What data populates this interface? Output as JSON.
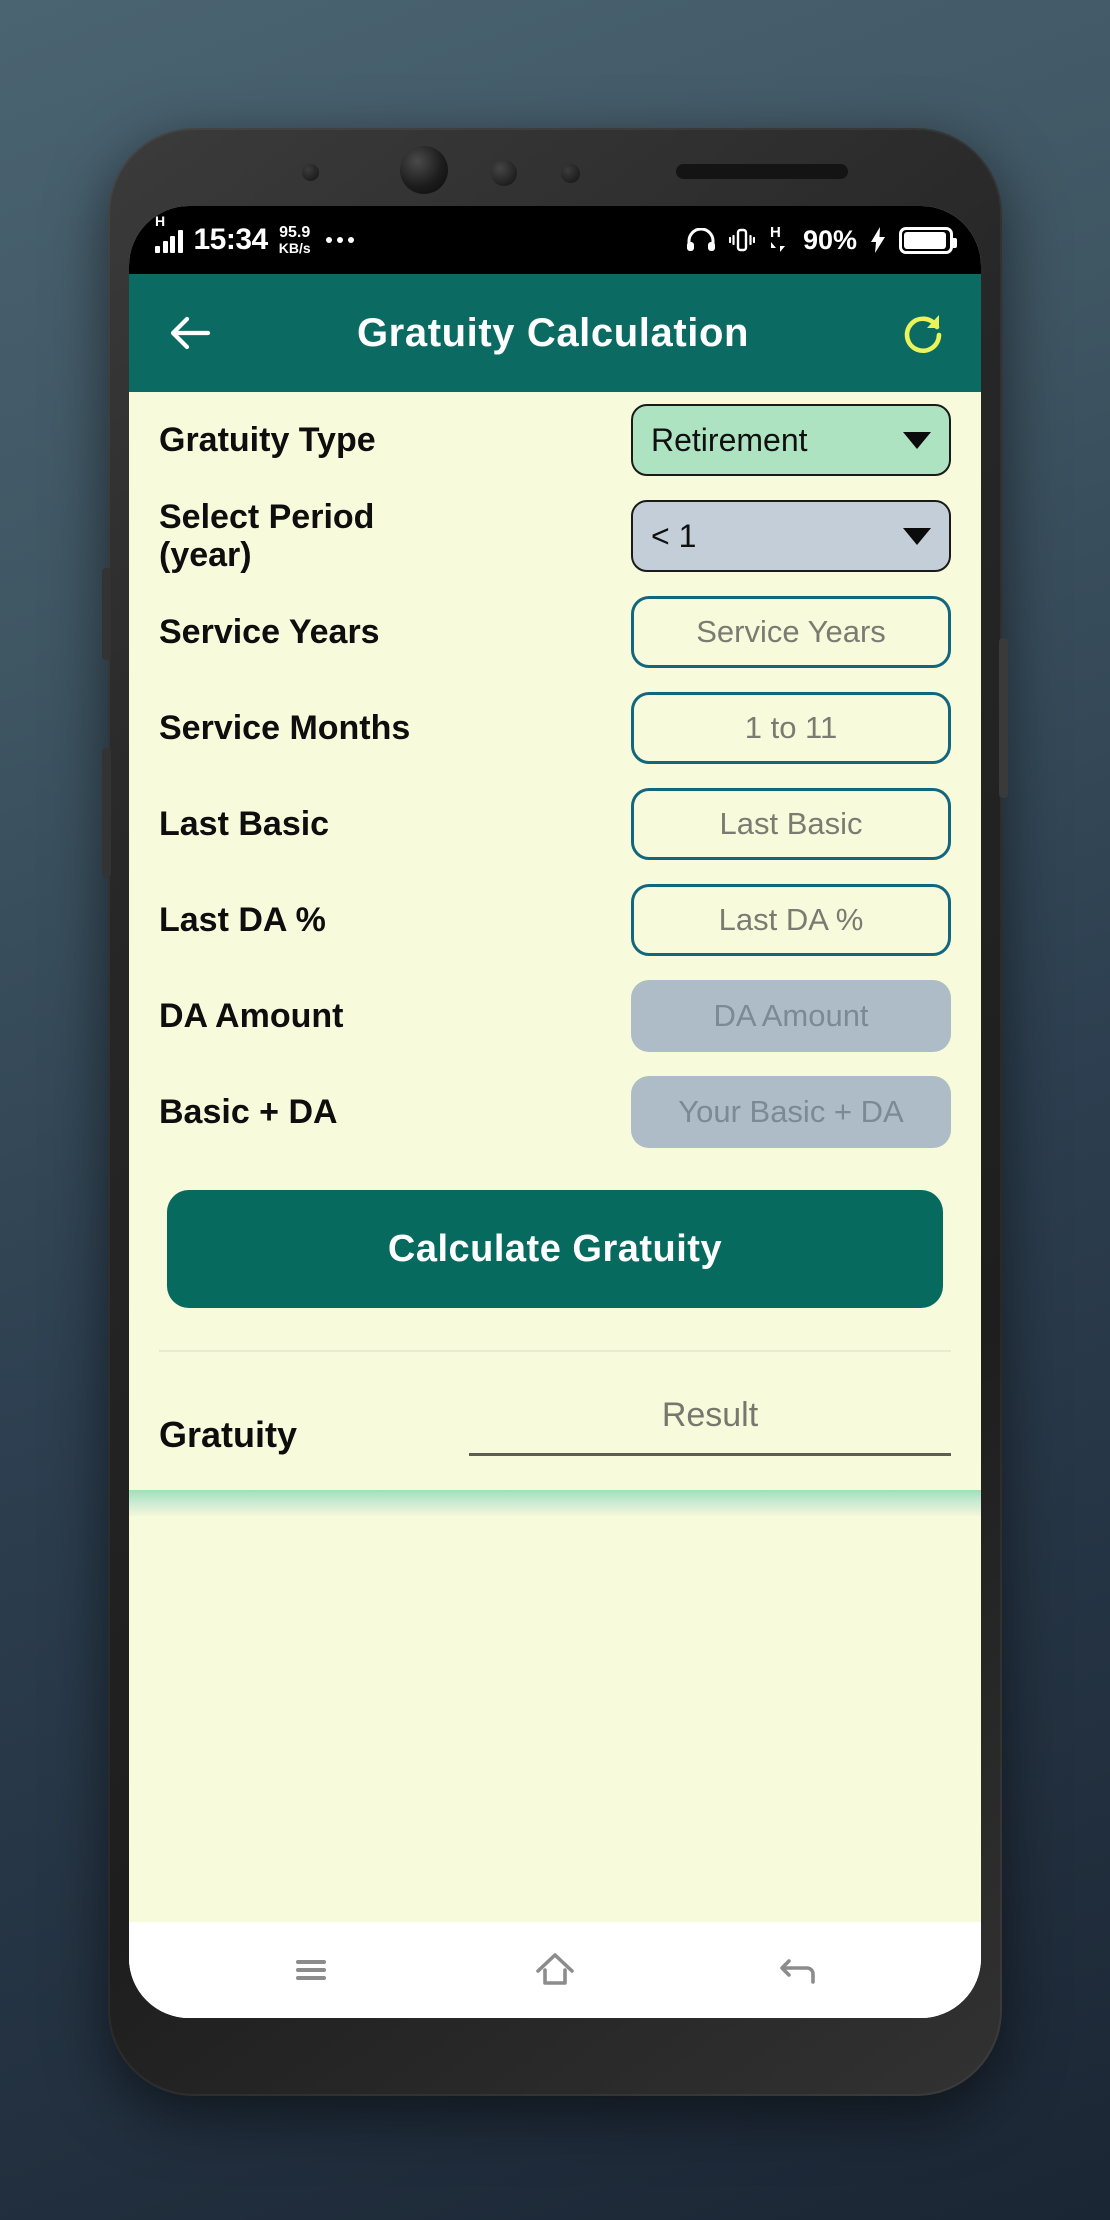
{
  "status_bar": {
    "network_type": "H",
    "signal_icon": "signal-bars-icon",
    "time": "15:34",
    "net_speed_value": "95.9",
    "net_speed_unit": "KB/s",
    "overflow_icon": "more-dots-icon",
    "headphones_icon": "headphones-icon",
    "vibrate_icon": "vibrate-icon",
    "data_type": "H",
    "battery_percent": "90%",
    "charging_icon": "lightning-bolt-icon",
    "battery_icon": "battery-icon"
  },
  "app_bar": {
    "back_icon": "back-arrow-icon",
    "title": "Gratuity Calculation",
    "refresh_icon": "refresh-icon",
    "background_color": "#0b6b62",
    "refresh_color": "#eaf35a"
  },
  "form": {
    "rows": [
      {
        "label": "Gratuity Type",
        "control": "dropdown",
        "value": "Retirement",
        "style": "green"
      },
      {
        "label": "Select Period (year)",
        "control": "dropdown",
        "value": "< 1",
        "style": "grey"
      },
      {
        "label": "Service Years",
        "control": "textfield",
        "value": "",
        "placeholder": "Service Years",
        "disabled": false
      },
      {
        "label": "Service Months",
        "control": "textfield",
        "value": "",
        "placeholder": "1 to 11",
        "disabled": false
      },
      {
        "label": "Last Basic",
        "control": "textfield",
        "value": "",
        "placeholder": "Last Basic",
        "disabled": false
      },
      {
        "label": "Last DA %",
        "control": "textfield",
        "value": "",
        "placeholder": "Last DA %",
        "disabled": false
      },
      {
        "label": "DA Amount",
        "control": "textfield",
        "value": "",
        "placeholder": "DA Amount",
        "disabled": true
      },
      {
        "label": "Basic + DA",
        "control": "textfield",
        "value": "",
        "placeholder": "Your Basic + DA",
        "disabled": true
      }
    ],
    "calculate_button": "Calculate Gratuity"
  },
  "result": {
    "label": "Gratuity",
    "placeholder": "Result",
    "value": ""
  },
  "nav_bar": {
    "recents_icon": "menu-icon",
    "home_icon": "home-icon",
    "back_icon": "back-icon"
  },
  "colors": {
    "accent_teal": "#0b6b62",
    "page_background": "#f7fbdc",
    "dropdown_green": "#aee3c2",
    "dropdown_grey": "#c3ced8",
    "field_border": "#12667e",
    "disabled_fill": "#adbcc6"
  }
}
